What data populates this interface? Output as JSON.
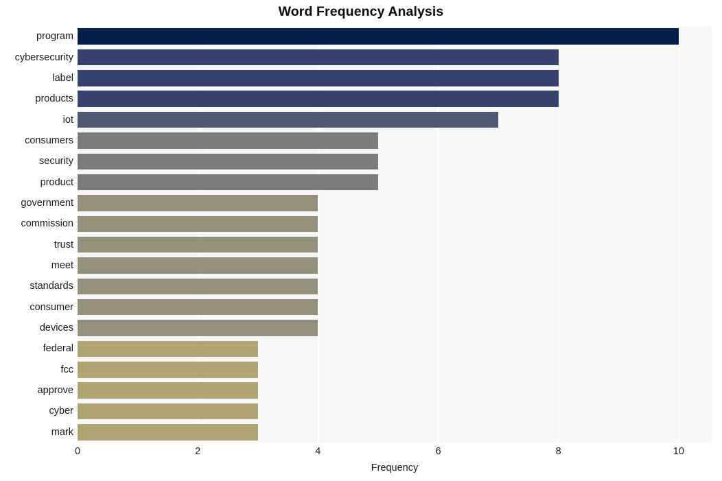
{
  "chart_data": {
    "type": "bar",
    "orientation": "horizontal",
    "title": "Word Frequency Analysis",
    "xlabel": "Frequency",
    "ylabel": "",
    "categories": [
      "program",
      "cybersecurity",
      "label",
      "products",
      "iot",
      "consumers",
      "security",
      "product",
      "government",
      "commission",
      "trust",
      "meet",
      "standards",
      "consumer",
      "devices",
      "federal",
      "fcc",
      "approve",
      "cyber",
      "mark"
    ],
    "values": [
      10,
      8,
      8,
      8,
      7,
      5,
      5,
      5,
      4,
      4,
      4,
      4,
      4,
      4,
      4,
      3,
      3,
      3,
      3,
      3
    ],
    "bar_colors": [
      "#042049",
      "#35436e",
      "#35436e",
      "#35436e",
      "#4e5772",
      "#7b7b79",
      "#7b7b79",
      "#7b7b79",
      "#94907c",
      "#94907c",
      "#94907c",
      "#94907c",
      "#94907c",
      "#94907c",
      "#94907c",
      "#b0a472",
      "#b0a472",
      "#b0a472",
      "#b0a472",
      "#b0a472"
    ],
    "xlim": [
      0,
      10.55
    ],
    "xticks": [
      0,
      2,
      4,
      6,
      8,
      10
    ],
    "xtick_labels": [
      "0",
      "2",
      "4",
      "6",
      "8",
      "10"
    ],
    "grid": {
      "vertical": true,
      "horizontal": false,
      "color": "#ffffff"
    },
    "legend": null,
    "plot_background": "#f7f7f7",
    "figure_background": "#ffffff",
    "text_color": "#1a1a1a"
  }
}
